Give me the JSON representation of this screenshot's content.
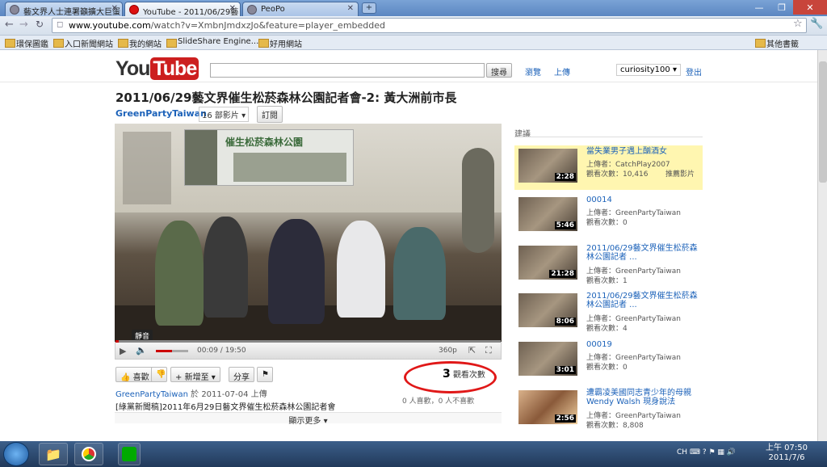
{
  "browser": {
    "tabs": [
      {
        "label": "藝文界人士連署籲擴大巨蛋"
      },
      {
        "label": "YouTube - 2011/06/29藝"
      },
      {
        "label": "PeoPo"
      }
    ],
    "new_tab_label": "+",
    "url_host": "www.youtube.com",
    "url_path": "/watch?v=XmbnJmdxzJo&feature=player_embedded",
    "bookmarks": [
      "環保圖鑑",
      "入口新聞網站",
      "我的網站",
      "SlideShare Engine...",
      "好用網站"
    ],
    "other_bookmarks": "其他書籤"
  },
  "youtube": {
    "logo_you": "You",
    "logo_tube": "Tube",
    "search_button": "搜尋",
    "nav_browse": "瀏覽",
    "nav_upload": "上傳",
    "username": "curiosity100",
    "signout": "登出"
  },
  "video": {
    "title": "2011/06/29藝文界催生松菸森林公園記者會-2: 黃大洲前市長",
    "channel": "GreenPartyTaiwan",
    "video_count": "16 部影片",
    "subscribe": "訂閱",
    "banner_text": "催生松菸森林公園",
    "time": "00:09 / 19:50",
    "quality": "360p",
    "mute_tooltip": "靜音",
    "progress_fraction": 0.008,
    "volume_fraction": 0.5,
    "buttons": {
      "like": "喜歡",
      "add": "新增至",
      "share": "分享"
    },
    "views_number": "3",
    "views_label": "觀看次數",
    "uploader_name": "GreenPartyTaiwan",
    "upload_info": "於 2011-07-04 上傳",
    "likes_text": "0 人喜歡，0 人不喜歡",
    "description": "[綠黨新聞稿]2011年6月29日藝文界催生松菸森林公園記者會",
    "show_more": "顯示更多"
  },
  "sidebar": {
    "heading": "建議",
    "items": [
      {
        "title": "當失業男子遇上酗酒女",
        "uploader": "上傳者：CatchPlay2007",
        "views": "觀看次數：10,416",
        "extra": "推薦影片",
        "duration": "2:28"
      },
      {
        "title": "00014",
        "uploader": "上傳者：GreenPartyTaiwan",
        "views": "觀看次數：0",
        "duration": "5:46"
      },
      {
        "title": "2011/06/29藝文界催生松菸森林公園記者 ...",
        "uploader": "上傳者：GreenPartyTaiwan",
        "views": "觀看次數：1",
        "duration": "21:28"
      },
      {
        "title": "2011/06/29藝文界催生松菸森林公園記者 ...",
        "uploader": "上傳者：GreenPartyTaiwan",
        "views": "觀看次數：4",
        "duration": "8:06"
      },
      {
        "title": "00019",
        "uploader": "上傳者：GreenPartyTaiwan",
        "views": "觀看次數：0",
        "duration": "3:01"
      },
      {
        "title": "遭霸凌美國同志青少年的母親Wendy Walsh 現身說法",
        "uploader": "上傳者：GreenPartyTaiwan",
        "views": "觀看次數：8,808",
        "duration": "2:56"
      }
    ]
  },
  "taskbar": {
    "lang": "CH",
    "time": "上午 07:50",
    "date": "2011/7/6"
  }
}
